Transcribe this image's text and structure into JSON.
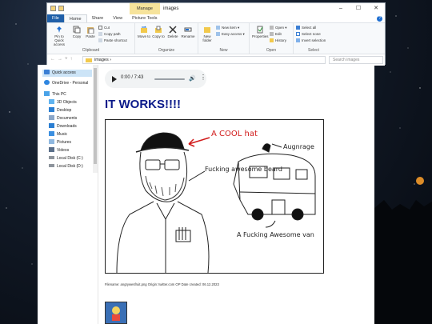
{
  "window": {
    "title": "images",
    "manage_tab": "Manage",
    "controls": [
      "–",
      "☐",
      "✕"
    ]
  },
  "ribbon_tabs": [
    "File",
    "Home",
    "Share",
    "View",
    "Picture Tools"
  ],
  "ribbon": {
    "clipboard": {
      "pin": "Pin to Quick access",
      "copy": "Copy",
      "paste": "Paste",
      "cut": "Cut",
      "copy_path": "Copy path",
      "paste_shortcut": "Paste shortcut",
      "label": "Clipboard"
    },
    "organize": {
      "move_to": "Move to",
      "copy_to": "Copy to",
      "delete": "Delete",
      "rename": "Rename",
      "label": "Organize"
    },
    "new": {
      "new_folder": "New folder",
      "new_item": "New item",
      "easy_access": "Easy access",
      "label": "New"
    },
    "open": {
      "properties": "Properties",
      "open": "Open",
      "edit": "Edit",
      "history": "History",
      "label": "Open"
    },
    "select": {
      "select_all": "Select all",
      "select_none": "Select none",
      "invert": "Invert selection",
      "label": "Select"
    }
  },
  "address": {
    "path": "images  ›",
    "search_placeholder": "Search images"
  },
  "nav": {
    "quick_access": "Quick access",
    "onedrive": "OneDrive - Personal",
    "this_pc": "This PC",
    "objects3d": "3D Objects",
    "desktop": "Desktop",
    "documents": "Documents",
    "downloads": "Downloads",
    "music": "Music",
    "pictures": "Pictures",
    "videos": "Videos",
    "local_c": "Local Disk (C:)",
    "local_d": "Local Disk (D:)"
  },
  "player": {
    "time": "0:00 / 7:43"
  },
  "page": {
    "headline": "IT WORKS!!!!",
    "caption": "Filename: angrywesfruit.png Origin: twitter.com OP Date created: 06.12.2023",
    "drawing_texts": {
      "hat": "A COOL hat",
      "beard": "Fucking awesome beard",
      "aughrage": "Augnrage",
      "van": "A Fucking Awesome van"
    }
  },
  "colors": {
    "accent": "#1f5fa8",
    "headline": "#0b1a8a",
    "annotation_red": "#d11a1a"
  }
}
